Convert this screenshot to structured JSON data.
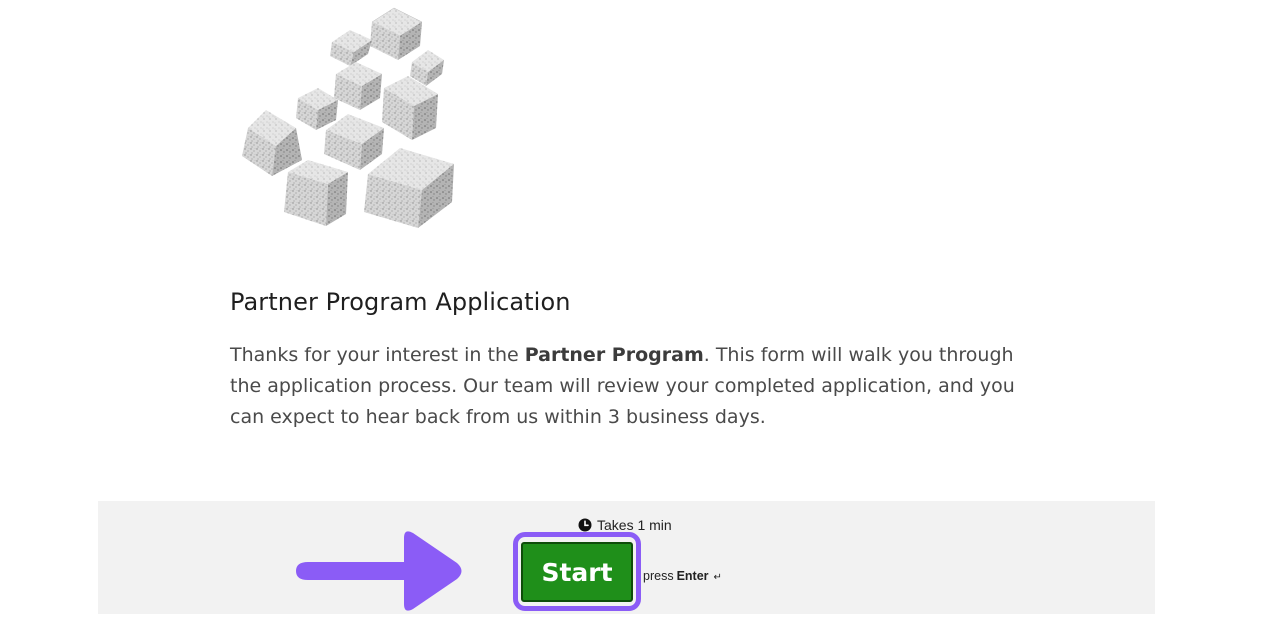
{
  "intro": {
    "title": "Partner Program Application",
    "description_before": "Thanks for your interest in the ",
    "description_bold": "Partner Program",
    "description_after": ". This form will walk you through the application process. Our team will review your completed application, and you can expect to hear back from us within 3 business days.",
    "illustration_icon": "cubes-illustration"
  },
  "footer": {
    "duration_icon": "clock-icon",
    "duration_text": "Takes 1 min",
    "start_label": "Start",
    "press_label": "press",
    "key_label": "Enter",
    "enter_glyph": "↵",
    "highlight_color": "#8b5cf6",
    "start_color": "#1f8f1a",
    "annotation_icon": "arrow-right-icon"
  }
}
